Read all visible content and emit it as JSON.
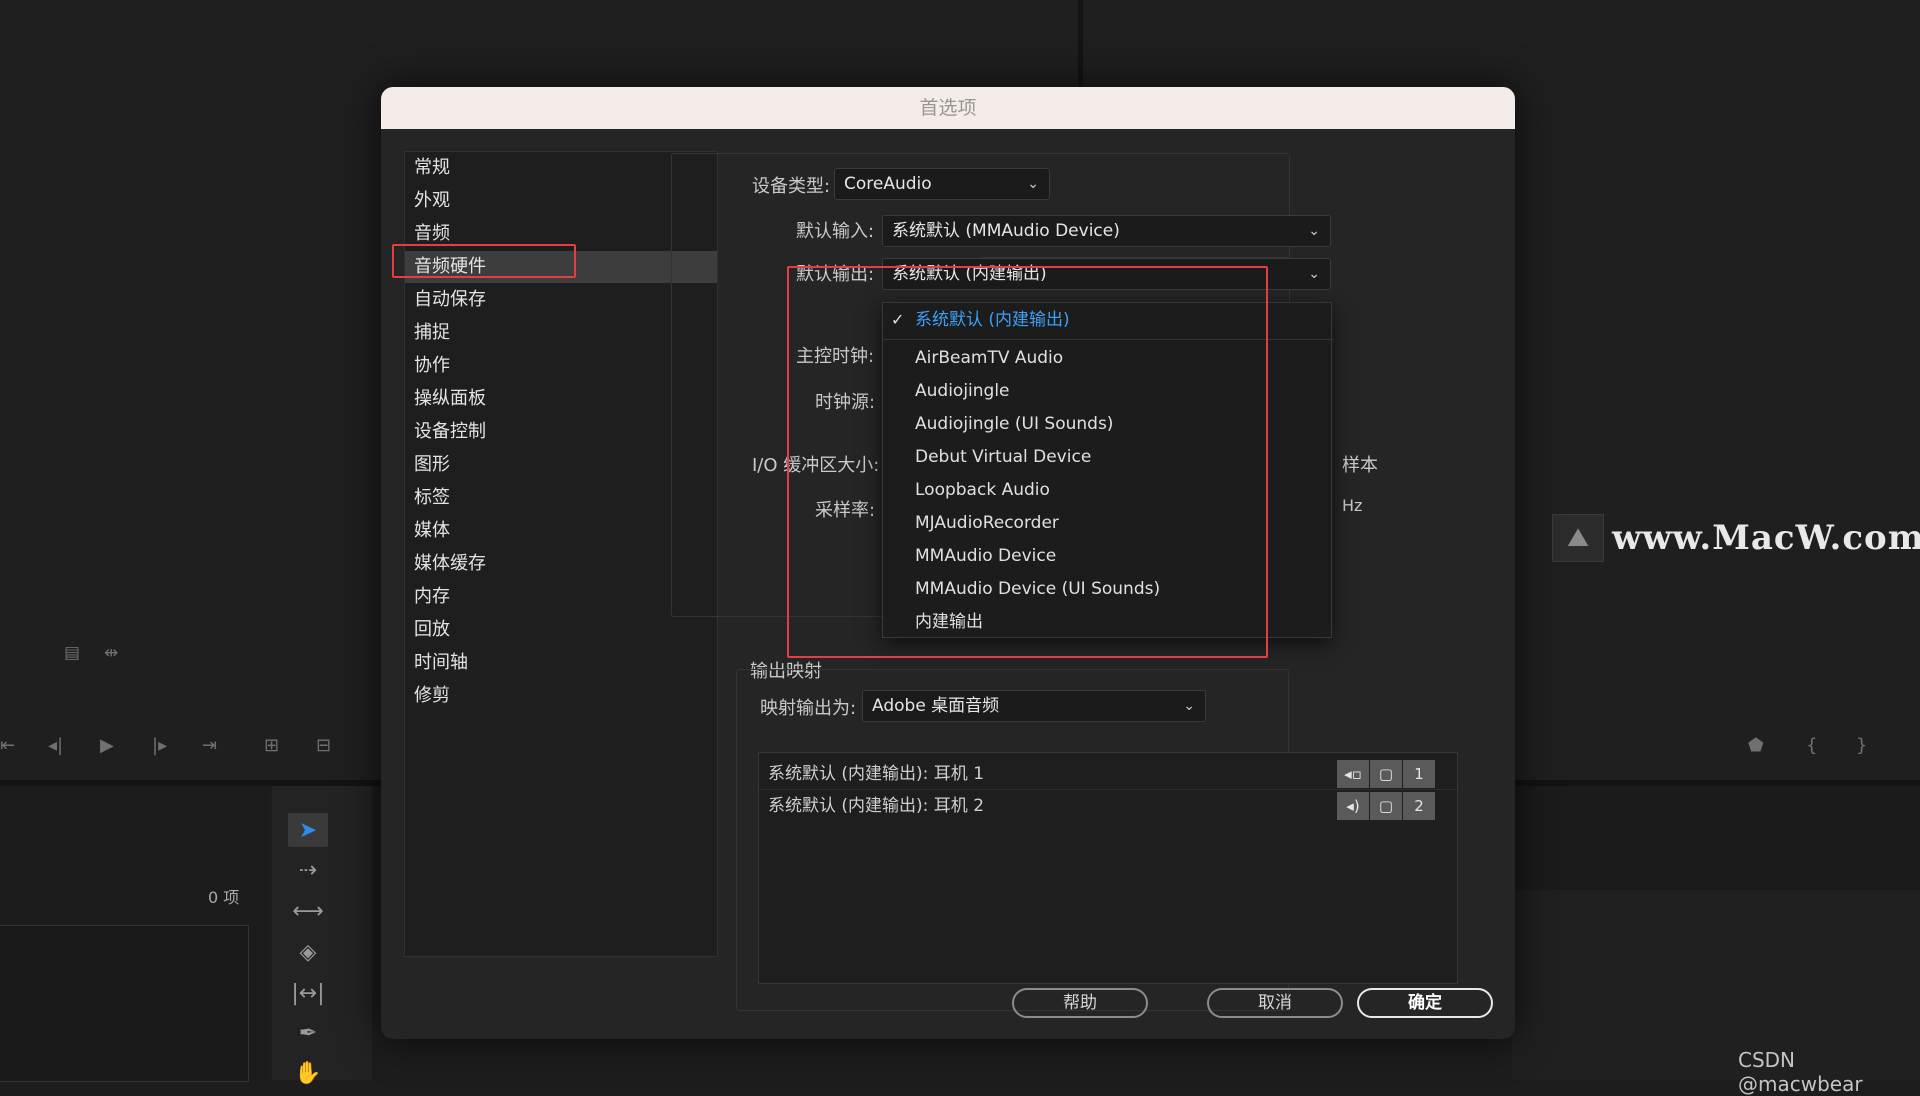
{
  "dialog": {
    "title": "首选项"
  },
  "nav": {
    "items": [
      {
        "label": "常规"
      },
      {
        "label": "外观"
      },
      {
        "label": "音频"
      },
      {
        "label": "音频硬件"
      },
      {
        "label": "自动保存"
      },
      {
        "label": "捕捉"
      },
      {
        "label": "协作"
      },
      {
        "label": "操纵面板"
      },
      {
        "label": "设备控制"
      },
      {
        "label": "图形"
      },
      {
        "label": "标签"
      },
      {
        "label": "媒体"
      },
      {
        "label": "媒体缓存"
      },
      {
        "label": "内存"
      },
      {
        "label": "回放"
      },
      {
        "label": "时间轴"
      },
      {
        "label": "修剪"
      }
    ],
    "selected": "音频硬件"
  },
  "hardware": {
    "device_type_label": "设备类型:",
    "device_type_value": "CoreAudio",
    "default_input_label": "默认输入:",
    "default_input_value": "系统默认 (MMAudio Device)",
    "default_output_label": "默认输出:",
    "default_output_value": "系统默认 (内建输出)",
    "master_clock_label": "主控时钟:",
    "clock_source_label": "时钟源:",
    "io_buffer_label": "I/O 缓冲区大小:",
    "io_buffer_unit": "样本",
    "sample_rate_label": "采样率:",
    "sample_rate_unit": "Hz"
  },
  "output_dropdown": {
    "selected_label": "系统默认 (内建输出)",
    "options": [
      "AirBeamTV Audio",
      "Audiojingle",
      "Audiojingle (UI Sounds)",
      "Debut Virtual Device",
      "Loopback Audio",
      "MJAudioRecorder",
      "MMAudio Device",
      "MMAudio Device (UI Sounds)",
      "内建输出"
    ]
  },
  "output_mapping": {
    "section_label": "输出映射",
    "map_to_label": "映射输出为:",
    "map_to_value": "Adobe 桌面音频",
    "rows": [
      {
        "label": "系统默认 (内建输出): 耳机 1",
        "channel": "1"
      },
      {
        "label": "系统默认 (内建输出): 耳机 2",
        "channel": "2"
      }
    ]
  },
  "buttons": {
    "help": "帮助",
    "cancel": "取消",
    "ok": "确定"
  },
  "background": {
    "item_count": "0 项",
    "watermark": "www.MacW.com",
    "credit": "CSDN @macwbear"
  },
  "colors": {
    "highlight_box": "#e04040",
    "selected_text": "#3e9ff5",
    "active_tool": "#2d8ceb"
  }
}
